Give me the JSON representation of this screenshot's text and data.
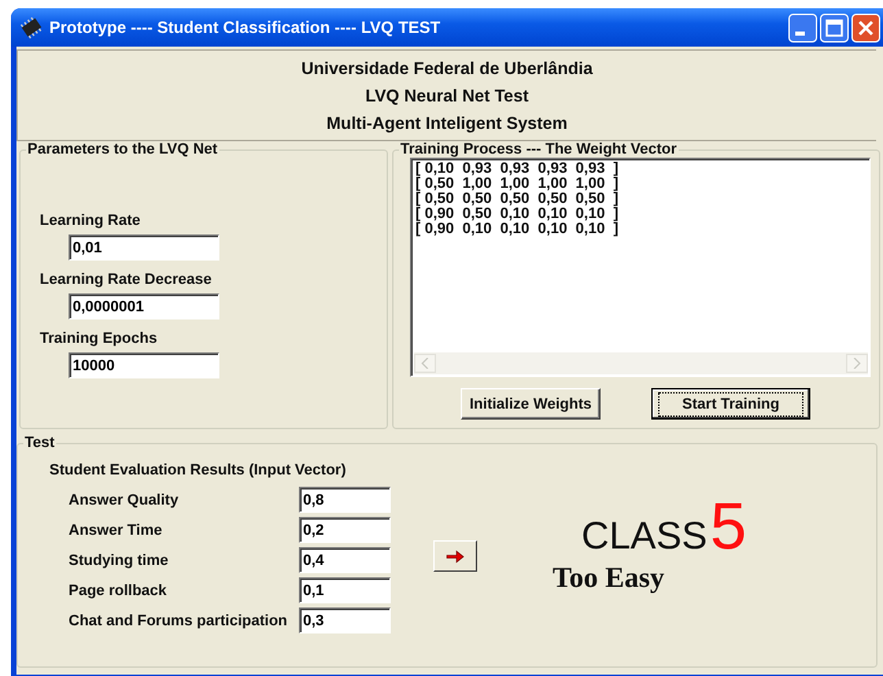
{
  "window": {
    "title": "Prototype ---- Student Classification ---- LVQ TEST"
  },
  "header": [
    "Universidade Federal de Uberlândia",
    "LVQ Neural Net Test",
    "Multi-Agent Inteligent System"
  ],
  "parameters": {
    "title": "Parameters to the LVQ Net",
    "fields": [
      {
        "label": "Learning Rate",
        "value": "0,01"
      },
      {
        "label": "Learning Rate Decrease",
        "value": "0,0000001"
      },
      {
        "label": "Training Epochs",
        "value": "10000"
      }
    ]
  },
  "training": {
    "title": "Training Process --- The Weight Vector",
    "rows": [
      "[ 0,10  0,93  0,93  0,93  0,93  ]",
      "[ 0,50  1,00  1,00  1,00  1,00  ]",
      "[ 0,50  0,50  0,50  0,50  0,50  ]",
      "[ 0,90  0,50  0,10  0,10  0,10  ]",
      "[ 0,90  0,10  0,10  0,10  0,10  ]"
    ],
    "buttons": [
      {
        "label": "Initialize Weights",
        "focused": false
      },
      {
        "label": "Start Training",
        "focused": true
      }
    ]
  },
  "test": {
    "title": "Test",
    "subtitle": "Student Evaluation Results (Input Vector)",
    "inputs": [
      {
        "label": "Answer Quality",
        "value": "0,8"
      },
      {
        "label": "Answer Time",
        "value": "0,2"
      },
      {
        "label": "Studying time",
        "value": "0,4"
      },
      {
        "label": "Page rollback",
        "value": "0,1"
      },
      {
        "label": "Chat and Forums participation",
        "value": "0,3"
      }
    ],
    "result": {
      "class_label": "CLASS",
      "class_number": "5",
      "description": "Too Easy"
    }
  }
}
